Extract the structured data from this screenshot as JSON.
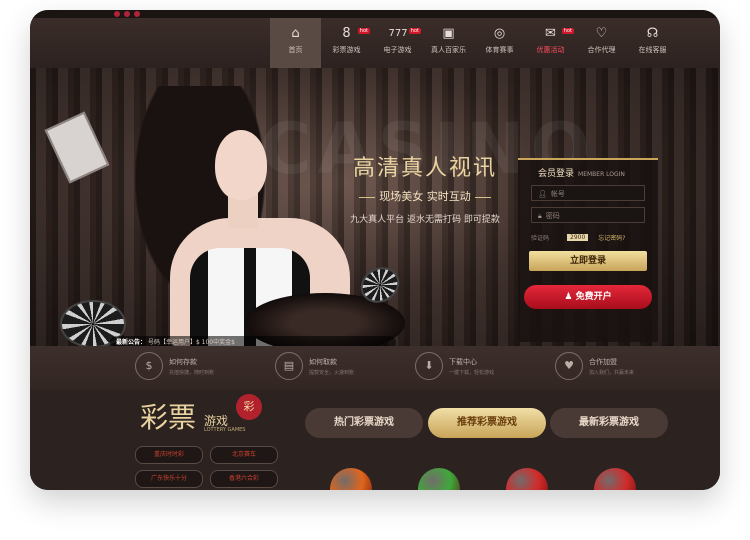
{
  "topbar": {
    "left_text": "",
    "right_text": ""
  },
  "nav": {
    "items": [
      {
        "label": "首页",
        "icon": "home-icon",
        "glyph": "⌂",
        "badge": ""
      },
      {
        "label": "彩票游戏",
        "icon": "lottery-icon",
        "glyph": "8",
        "badge": "hot"
      },
      {
        "label": "电子游戏",
        "icon": "slot-icon",
        "glyph": "777",
        "badge": "hot"
      },
      {
        "label": "真人百家乐",
        "icon": "cards-icon",
        "glyph": "▣",
        "badge": ""
      },
      {
        "label": "体育赛事",
        "icon": "ball-icon",
        "glyph": "◎",
        "badge": ""
      },
      {
        "label": "优惠活动",
        "icon": "gift-icon",
        "glyph": "✉",
        "badge": "hot"
      },
      {
        "label": "合作代理",
        "icon": "handshake-icon",
        "glyph": "♡",
        "badge": ""
      },
      {
        "label": "在线客服",
        "icon": "headset-icon",
        "glyph": "☊",
        "badge": ""
      }
    ]
  },
  "banner": {
    "bg_word": "CASINO",
    "headline": "高清真人视讯",
    "subline": "现场美女 实时互动",
    "tagline": "九大真人平台 返水无需打码 即可提款",
    "ticker_tag": "最新公告：",
    "ticker_text": "号码【幸运用户】$ 100中奖金$"
  },
  "login": {
    "title": "会员登录",
    "title_en": "MEMBER LOGIN",
    "account_placeholder": "帐号",
    "password_placeholder": "密码",
    "captcha_placeholder": "验证码",
    "captcha_value": "2900",
    "forgot_label": "忘记密码?",
    "login_button": "立即登录",
    "register_button": "免费开户"
  },
  "services": [
    {
      "title": "如何存款",
      "sub": "充值快捷，随时到账",
      "icon": "deposit-icon",
      "glyph": "$"
    },
    {
      "title": "如何取款",
      "sub": "提款安全，火速到账",
      "icon": "withdraw-icon",
      "glyph": "▤"
    },
    {
      "title": "下载中心",
      "sub": "一键下载，轻松游戏",
      "icon": "download-icon",
      "glyph": "⬇"
    },
    {
      "title": "合作加盟",
      "sub": "加入我们，共赢未来",
      "icon": "partner-icon",
      "glyph": "♥"
    }
  ],
  "lottery": {
    "logo_big": "彩票",
    "logo_small": "游戏",
    "logo_en": "LOTTERY GAMES",
    "logo_seal": "彩",
    "quick_links": [
      "重庆时时彩",
      "北京赛车",
      "广东快乐十分",
      "香港六合彩"
    ],
    "tabs": [
      "热门彩票游戏",
      "推荐彩票游戏",
      "最新彩票游戏"
    ],
    "balls": [
      {
        "name": "ball-orange",
        "color": "#e0651c"
      },
      {
        "name": "ball-green",
        "color": "#3fa83a"
      },
      {
        "name": "ball-red",
        "color": "#d32a2a"
      },
      {
        "name": "ball-multicolor",
        "color": "#d12b2b"
      }
    ]
  },
  "colors": {
    "accent_gold": "#c9a458",
    "accent_red": "#d0182a",
    "background": "#2a201e"
  }
}
